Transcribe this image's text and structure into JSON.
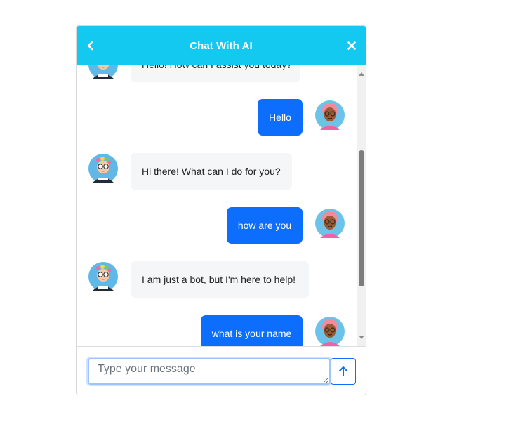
{
  "header": {
    "title": "Chat With AI",
    "back_icon": "chevron-left-icon",
    "close_icon": "close-icon",
    "color": "#13c9ef"
  },
  "messages": [
    {
      "sender": "bot",
      "text": "Hello! How can I assist you today?"
    },
    {
      "sender": "user",
      "text": "Hello"
    },
    {
      "sender": "bot",
      "text": "Hi there! What can I do for you?"
    },
    {
      "sender": "user",
      "text": "how are you"
    },
    {
      "sender": "bot",
      "text": "I am just a bot, but I'm here to help!"
    },
    {
      "sender": "user",
      "text": "what is your name"
    }
  ],
  "composer": {
    "placeholder": "Type your message",
    "value": "",
    "send_icon": "arrow-up-icon"
  },
  "colors": {
    "user_bubble": "#0d6efd",
    "bot_bubble": "#f4f6f8"
  }
}
